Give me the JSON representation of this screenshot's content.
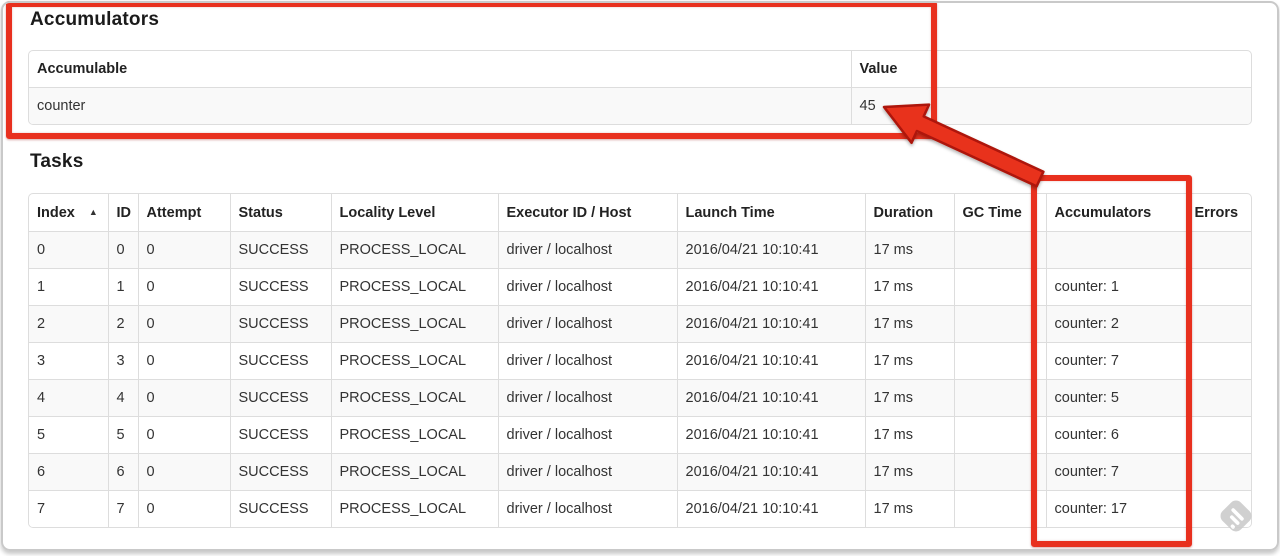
{
  "accumulators_section": {
    "title": "Accumulators",
    "table": {
      "headers": [
        "Accumulable",
        "Value"
      ],
      "rows": [
        {
          "accumulable": "counter",
          "value": "45"
        }
      ]
    }
  },
  "tasks_section": {
    "title": "Tasks",
    "table": {
      "headers": [
        "Index",
        "ID",
        "Attempt",
        "Status",
        "Locality Level",
        "Executor ID / Host",
        "Launch Time",
        "Duration",
        "GC Time",
        "Accumulators",
        "Errors"
      ],
      "sort": {
        "column": "Index",
        "icon": "▲"
      },
      "rows": [
        [
          "0",
          "0",
          "0",
          "SUCCESS",
          "PROCESS_LOCAL",
          "driver / localhost",
          "2016/04/21 10:10:41",
          "17 ms",
          "",
          "",
          ""
        ],
        [
          "1",
          "1",
          "0",
          "SUCCESS",
          "PROCESS_LOCAL",
          "driver / localhost",
          "2016/04/21 10:10:41",
          "17 ms",
          "",
          "counter: 1",
          ""
        ],
        [
          "2",
          "2",
          "0",
          "SUCCESS",
          "PROCESS_LOCAL",
          "driver / localhost",
          "2016/04/21 10:10:41",
          "17 ms",
          "",
          "counter: 2",
          ""
        ],
        [
          "3",
          "3",
          "0",
          "SUCCESS",
          "PROCESS_LOCAL",
          "driver / localhost",
          "2016/04/21 10:10:41",
          "17 ms",
          "",
          "counter: 7",
          ""
        ],
        [
          "4",
          "4",
          "0",
          "SUCCESS",
          "PROCESS_LOCAL",
          "driver / localhost",
          "2016/04/21 10:10:41",
          "17 ms",
          "",
          "counter: 5",
          ""
        ],
        [
          "5",
          "5",
          "0",
          "SUCCESS",
          "PROCESS_LOCAL",
          "driver / localhost",
          "2016/04/21 10:10:41",
          "17 ms",
          "",
          "counter: 6",
          ""
        ],
        [
          "6",
          "6",
          "0",
          "SUCCESS",
          "PROCESS_LOCAL",
          "driver / localhost",
          "2016/04/21 10:10:41",
          "17 ms",
          "",
          "counter: 7",
          ""
        ],
        [
          "7",
          "7",
          "0",
          "SUCCESS",
          "PROCESS_LOCAL",
          "driver / localhost",
          "2016/04/21 10:10:41",
          "17 ms",
          "",
          "counter: 17",
          ""
        ]
      ]
    }
  },
  "annotations": {
    "highlight_color": "#e8301e",
    "arrow_points_to_value": "45"
  }
}
